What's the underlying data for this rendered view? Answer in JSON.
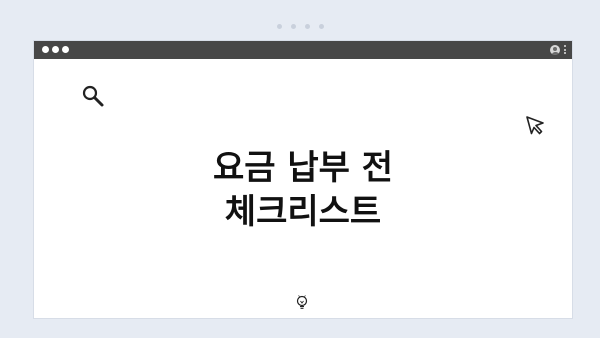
{
  "pager": {
    "dots": 4
  },
  "window": {
    "titlebar": {
      "controls": [
        "dot",
        "dot",
        "dot"
      ],
      "right_icons": [
        "profile-icon",
        "kebab-menu-icon"
      ]
    }
  },
  "content": {
    "heading_line1": "요금 납부 전",
    "heading_line2": "체크리스트",
    "icons": [
      "search-icon",
      "cursor-arrow-icon",
      "lightbulb-icon"
    ]
  },
  "colors": {
    "background": "#e6ebf3",
    "titlebar": "#474747",
    "card": "#ffffff",
    "text": "#111111"
  }
}
